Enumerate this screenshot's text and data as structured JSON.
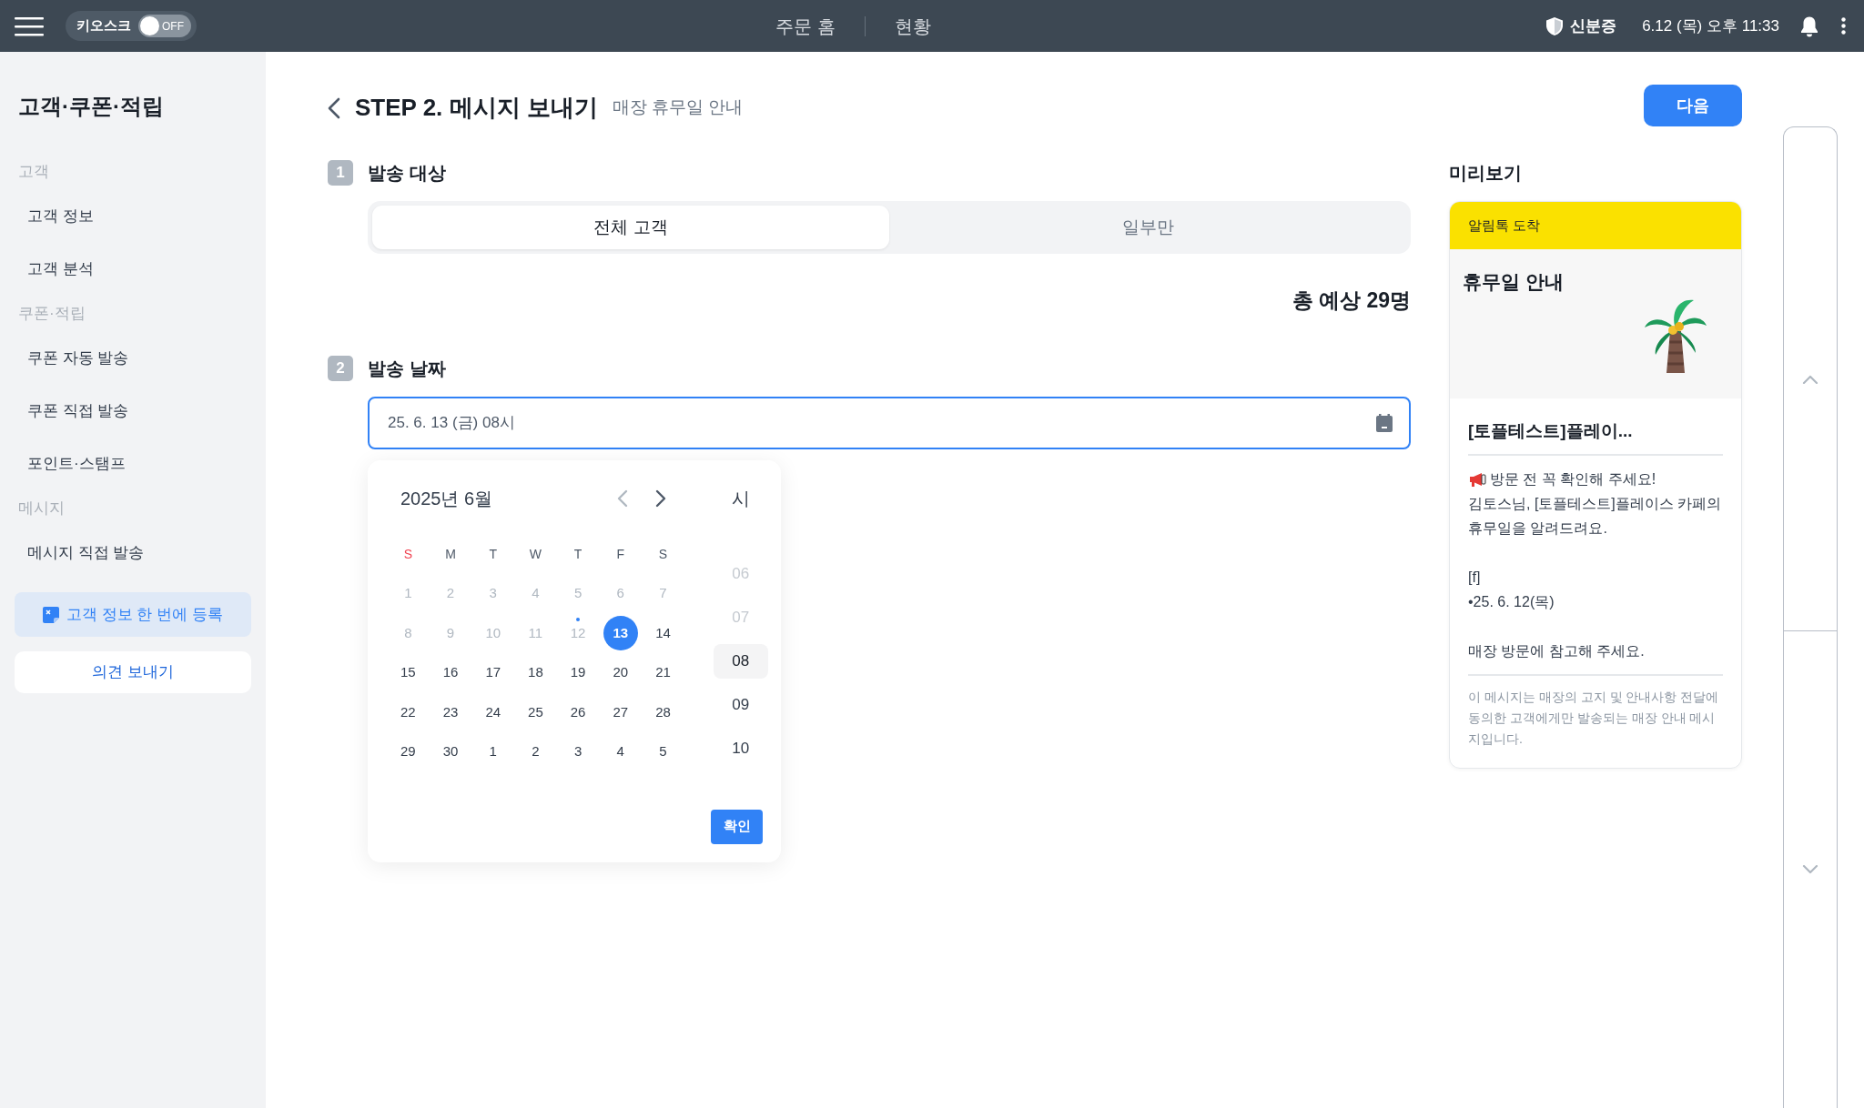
{
  "top_bar": {
    "kiosk": {
      "label": "키오스크",
      "on": false,
      "state_label": "OFF"
    },
    "nav": [
      {
        "label": "주문 홈"
      },
      {
        "label": "현황"
      }
    ],
    "id_label": "신분증",
    "datetime": "6.12 (목) 오후 11:33"
  },
  "sidebar": {
    "title": "고객·쿠폰·적립",
    "groups": [
      {
        "label": "고객",
        "items": [
          "고객 정보",
          "고객 분석"
        ]
      },
      {
        "label": "쿠폰·적립",
        "items": [
          "쿠폰 자동 발송",
          "쿠폰 직접 발송",
          "포인트·스탬프"
        ]
      },
      {
        "label": "메시지",
        "items": [
          "메시지 직접 발송"
        ]
      }
    ],
    "register_button": "고객 정보 한 번에 등록",
    "feedback_button": "의견 보내기"
  },
  "header": {
    "title": "STEP 2. 메시지 보내기",
    "subtitle": "매장 휴무일 안내",
    "next_button": "다음"
  },
  "target": {
    "number": "1",
    "label": "발송 대상",
    "options": [
      {
        "label": "전체 고객",
        "selected": true
      },
      {
        "label": "일부만",
        "selected": false
      }
    ],
    "total": "총 예상 29명"
  },
  "date": {
    "number": "2",
    "label": "발송 날짜",
    "value": "25. 6. 13 (금) 08시"
  },
  "calendar": {
    "month": "2025년 6월",
    "hour_label": "시",
    "weekdays": [
      {
        "label": "S",
        "holiday": true
      },
      {
        "label": "M",
        "holiday": false
      },
      {
        "label": "T",
        "holiday": false
      },
      {
        "label": "W",
        "holiday": false
      },
      {
        "label": "T",
        "holiday": false
      },
      {
        "label": "F",
        "holiday": false
      },
      {
        "label": "S",
        "holiday": false
      }
    ],
    "days": [
      {
        "label": "1",
        "disabled": true,
        "selected": false,
        "today": false
      },
      {
        "label": "2",
        "disabled": true,
        "selected": false,
        "today": false
      },
      {
        "label": "3",
        "disabled": true,
        "selected": false,
        "today": false
      },
      {
        "label": "4",
        "disabled": true,
        "selected": false,
        "today": false
      },
      {
        "label": "5",
        "disabled": true,
        "selected": false,
        "today": false
      },
      {
        "label": "6",
        "disabled": true,
        "selected": false,
        "today": false
      },
      {
        "label": "7",
        "disabled": true,
        "selected": false,
        "today": false
      },
      {
        "label": "8",
        "disabled": true,
        "selected": false,
        "today": false
      },
      {
        "label": "9",
        "disabled": true,
        "selected": false,
        "today": false
      },
      {
        "label": "10",
        "disabled": true,
        "selected": false,
        "today": false
      },
      {
        "label": "11",
        "disabled": true,
        "selected": false,
        "today": false
      },
      {
        "label": "12",
        "disabled": true,
        "selected": false,
        "today": true
      },
      {
        "label": "13",
        "disabled": false,
        "selected": true,
        "today": false
      },
      {
        "label": "14",
        "disabled": false,
        "selected": false,
        "today": false
      },
      {
        "label": "15",
        "disabled": false,
        "selected": false,
        "today": false
      },
      {
        "label": "16",
        "disabled": false,
        "selected": false,
        "today": false
      },
      {
        "label": "17",
        "disabled": false,
        "selected": false,
        "today": false
      },
      {
        "label": "18",
        "disabled": false,
        "selected": false,
        "today": false
      },
      {
        "label": "19",
        "disabled": false,
        "selected": false,
        "today": false
      },
      {
        "label": "20",
        "disabled": false,
        "selected": false,
        "today": false
      },
      {
        "label": "21",
        "disabled": false,
        "selected": false,
        "today": false
      },
      {
        "label": "22",
        "disabled": false,
        "selected": false,
        "today": false
      },
      {
        "label": "23",
        "disabled": false,
        "selected": false,
        "today": false
      },
      {
        "label": "24",
        "disabled": false,
        "selected": false,
        "today": false
      },
      {
        "label": "25",
        "disabled": false,
        "selected": false,
        "today": false
      },
      {
        "label": "26",
        "disabled": false,
        "selected": false,
        "today": false
      },
      {
        "label": "27",
        "disabled": false,
        "selected": false,
        "today": false
      },
      {
        "label": "28",
        "disabled": false,
        "selected": false,
        "today": false
      },
      {
        "label": "29",
        "disabled": false,
        "selected": false,
        "today": false
      },
      {
        "label": "30",
        "disabled": false,
        "selected": false,
        "today": false
      },
      {
        "label": "1",
        "disabled": false,
        "selected": false,
        "today": false
      },
      {
        "label": "2",
        "disabled": false,
        "selected": false,
        "today": false
      },
      {
        "label": "3",
        "disabled": false,
        "selected": false,
        "today": false
      },
      {
        "label": "4",
        "disabled": false,
        "selected": false,
        "today": false
      },
      {
        "label": "5",
        "disabled": false,
        "selected": false,
        "today": false
      }
    ],
    "hours": [
      {
        "label": "06",
        "disabled": true,
        "selected": false
      },
      {
        "label": "07",
        "disabled": true,
        "selected": false
      },
      {
        "label": "08",
        "disabled": false,
        "selected": true
      },
      {
        "label": "09",
        "disabled": false,
        "selected": false
      },
      {
        "label": "10",
        "disabled": false,
        "selected": false
      }
    ],
    "confirm_button": "확인"
  },
  "preview": {
    "label": "미리보기",
    "badge": "알림톡 도착",
    "title": "휴무일 안내",
    "store": "[토플테스트]플레이...",
    "intro": "방문 전 꼭 확인해 주세요!",
    "greeting": "김토스님, [토플테스트]플레이스 카페의 휴무일을 알려드려요.",
    "dates_label": "[f]",
    "dates": [
      "•25. 6. 12(목)"
    ],
    "closing": "매장 방문에 참고해 주세요.",
    "note": "이 메시지는 매장의 고지 및 안내사항 전달에 동의한 고객에게만 발송되는 매장 안내 메시지입니다."
  }
}
